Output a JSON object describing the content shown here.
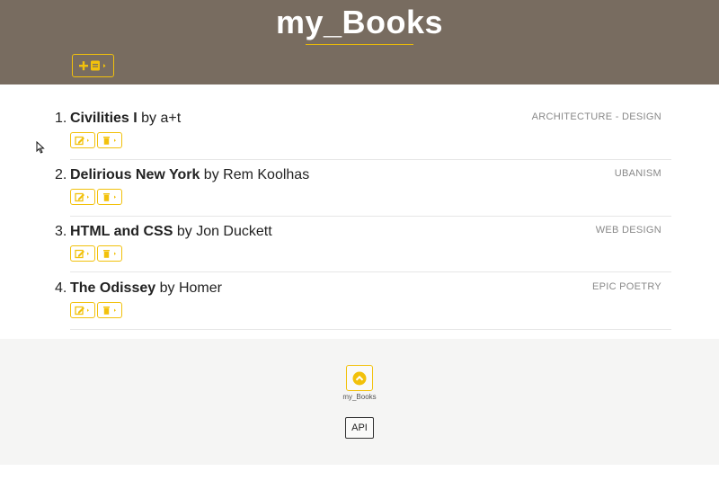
{
  "header": {
    "title": "my_Books",
    "add_button_icon": "add-book-icon"
  },
  "books": [
    {
      "number": "1.",
      "title": "Civilities I",
      "by": "by",
      "author": "a+t",
      "category": "ARCHITECTURE - DESIGN"
    },
    {
      "number": "2.",
      "title": "Delirious New York",
      "by": "by",
      "author": "Rem Koolhas",
      "category": "UBANISM"
    },
    {
      "number": "3.",
      "title": "HTML and CSS",
      "by": "by",
      "author": "Jon Duckett",
      "category": "WEB DESIGN"
    },
    {
      "number": "4.",
      "title": "The Odissey",
      "by": "by",
      "author": "Homer",
      "category": "EPIC POETRY"
    }
  ],
  "footer": {
    "label": "my_Books",
    "api_label": "API"
  },
  "colors": {
    "header_bg": "#786c60",
    "accent": "#f2c10b",
    "footer_bg": "#f5f5f4"
  }
}
